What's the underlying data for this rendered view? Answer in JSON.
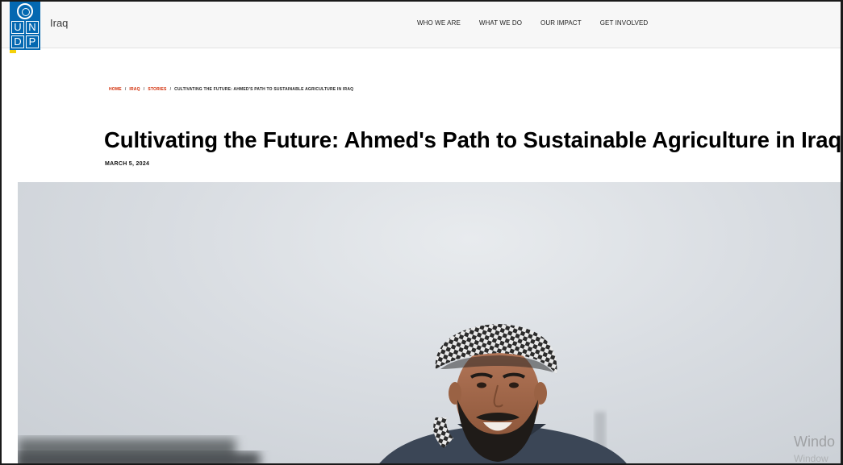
{
  "header": {
    "logo": {
      "letters": [
        "U",
        "N",
        "D",
        "P"
      ],
      "brand_color": "#0468b1",
      "marker_color": "#f5d10a"
    },
    "country": "Iraq",
    "nav": [
      {
        "label": "WHO WE ARE"
      },
      {
        "label": "WHAT WE DO"
      },
      {
        "label": "OUR IMPACT"
      },
      {
        "label": "GET INVOLVED"
      }
    ]
  },
  "breadcrumb": {
    "items": [
      "HOME",
      "IRAQ",
      "STORIES"
    ],
    "separator": "/",
    "current": "CULTIVATING THE FUTURE: AHMED'S PATH TO SUSTAINABLE AGRICULTURE IN IRAQ",
    "link_color": "#d12800"
  },
  "article": {
    "title": "Cultivating the Future: Ahmed's Path to Sustainable Agriculture in Iraq",
    "date": "MARCH 5, 2024"
  },
  "hero_image": {
    "subject": "portrait-man-checkered-headscarf"
  },
  "watermark": {
    "line1": "Windo",
    "line2": "Window"
  }
}
